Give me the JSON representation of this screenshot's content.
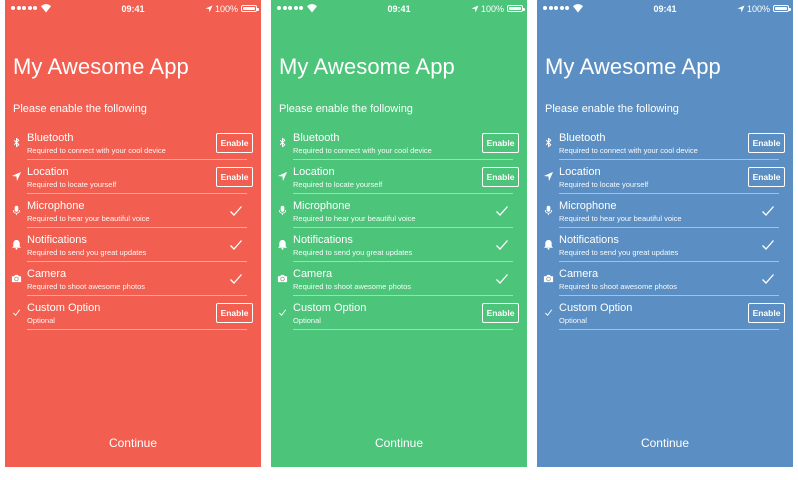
{
  "status_bar": {
    "time": "09:41",
    "battery": "100%"
  },
  "app_title": "My Awesome App",
  "subtitle": "Please enable the following",
  "continue_label": "Continue",
  "enable_label": "Enable",
  "phones": [
    {
      "theme_color": "#F25E50",
      "rows": [
        {
          "label": "Bluetooth",
          "desc": "Required to connect with your cool device",
          "icon": "bluetooth-icon",
          "state": "enable"
        },
        {
          "label": "Location",
          "desc": "Required to locate yourself",
          "icon": "location-arrow-icon",
          "state": "enable"
        },
        {
          "label": "Microphone",
          "desc": "Required to hear your beautiful voice",
          "icon": "microphone-icon",
          "state": "checked"
        },
        {
          "label": "Notifications",
          "desc": "Required to send you great updates",
          "icon": "bell-icon",
          "state": "checked"
        },
        {
          "label": "Camera",
          "desc": "Required to shoot awesome photos",
          "icon": "camera-icon",
          "state": "checked"
        },
        {
          "label": "Custom Option",
          "desc": "Optional",
          "icon": "checkmark-icon",
          "state": "enable"
        }
      ]
    },
    {
      "theme_color": "#4CC47A",
      "rows": [
        {
          "label": "Bluetooth",
          "desc": "Required to connect with your cool device",
          "icon": "bluetooth-icon",
          "state": "enable"
        },
        {
          "label": "Location",
          "desc": "Required to locate yourself",
          "icon": "location-arrow-icon",
          "state": "enable"
        },
        {
          "label": "Microphone",
          "desc": "Required to hear your beautiful voice",
          "icon": "microphone-icon",
          "state": "checked"
        },
        {
          "label": "Notifications",
          "desc": "Required to send you great updates",
          "icon": "bell-icon",
          "state": "checked"
        },
        {
          "label": "Camera",
          "desc": "Required to shoot awesome photos",
          "icon": "camera-icon",
          "state": "checked"
        },
        {
          "label": "Custom Option",
          "desc": "Optional",
          "icon": "checkmark-icon",
          "state": "enable"
        }
      ]
    },
    {
      "theme_color": "#5B8FC3",
      "rows": [
        {
          "label": "Bluetooth",
          "desc": "Required to connect with your cool device",
          "icon": "bluetooth-icon",
          "state": "enable"
        },
        {
          "label": "Location",
          "desc": "Required to locate yourself",
          "icon": "location-arrow-icon",
          "state": "enable"
        },
        {
          "label": "Microphone",
          "desc": "Required to hear your beautiful voice",
          "icon": "microphone-icon",
          "state": "checked"
        },
        {
          "label": "Notifications",
          "desc": "Required to send you great updates",
          "icon": "bell-icon",
          "state": "checked"
        },
        {
          "label": "Camera",
          "desc": "Required to shoot awesome photos",
          "icon": "camera-icon",
          "state": "checked"
        },
        {
          "label": "Custom Option",
          "desc": "Optional",
          "icon": "checkmark-icon",
          "state": "enable"
        }
      ]
    }
  ]
}
